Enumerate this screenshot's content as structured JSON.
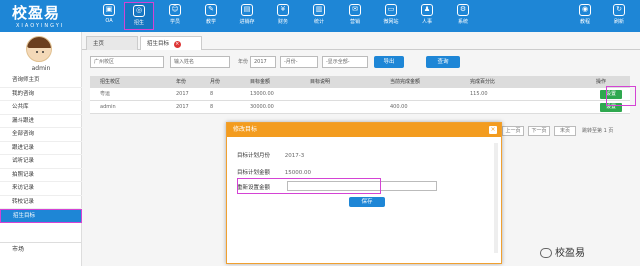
{
  "header": {
    "logo_title": "校盈易",
    "logo_sub": "XIAOYINGYI",
    "nav": [
      {
        "label": "OA",
        "icon": "oa-icon",
        "glyph": "▣"
      },
      {
        "label": "招生",
        "icon": "target-icon",
        "glyph": "◎"
      },
      {
        "label": "学员",
        "icon": "student-icon",
        "glyph": "☺"
      },
      {
        "label": "教学",
        "icon": "teach-icon",
        "glyph": "✎"
      },
      {
        "label": "进销存",
        "icon": "stock-icon",
        "glyph": "▤"
      },
      {
        "label": "财务",
        "icon": "finance-icon",
        "glyph": "¥"
      },
      {
        "label": "统计",
        "icon": "stats-icon",
        "glyph": "▥"
      },
      {
        "label": "营销",
        "icon": "marketing-icon",
        "glyph": "✉"
      },
      {
        "label": "微网站",
        "icon": "microsite-icon",
        "glyph": "▭"
      },
      {
        "label": "人事",
        "icon": "hr-icon",
        "glyph": "♟"
      },
      {
        "label": "系统",
        "icon": "system-icon",
        "glyph": "⚙"
      }
    ],
    "right": [
      {
        "label": "教程",
        "icon": "tutorial-icon",
        "glyph": "◉"
      },
      {
        "label": "刷新",
        "icon": "refresh-icon",
        "glyph": "↻"
      }
    ]
  },
  "sidebar": {
    "username": "admin",
    "items": [
      "咨询师主页",
      "我的咨询",
      "公共库",
      "漏斗跟进",
      "全部咨询",
      "跟进记录",
      "试听记录",
      "拍照记录",
      "来访记录",
      "转校记录",
      "招生目标"
    ],
    "market": "市场"
  },
  "tabs": [
    "主页",
    "招生目标"
  ],
  "filters": {
    "campus": "广州校区",
    "search": "输入姓名",
    "year_label": "年份",
    "year": "2017",
    "month": "-月份-",
    "display": "-显示全部-",
    "export": "导出",
    "query": "查询"
  },
  "table": {
    "headers": [
      "招生校区",
      "年份",
      "月份",
      "目标金额",
      "目标说明",
      "当前完成金额",
      "完成百分比",
      "操作"
    ],
    "rows": [
      [
        "粤运",
        "2017",
        "8",
        "13000.00",
        "",
        "",
        "115.00",
        "设置"
      ],
      [
        "admin",
        "2017",
        "8",
        "30000.00",
        "",
        "400.00",
        "",
        "设置"
      ]
    ]
  },
  "pager": {
    "prev": "上一页",
    "next": "下一页",
    "last": "末页",
    "page_label": "跳转至第 1 页"
  },
  "modal": {
    "title": "修改目标",
    "close": "×",
    "plan_month_label": "目标计划月份",
    "plan_month": "2017-3",
    "plan_amount_label": "目标计划金额",
    "plan_amount": "15000.00",
    "reset_label": "重新设置金额",
    "save": "保存"
  },
  "watermark": "校盈易"
}
